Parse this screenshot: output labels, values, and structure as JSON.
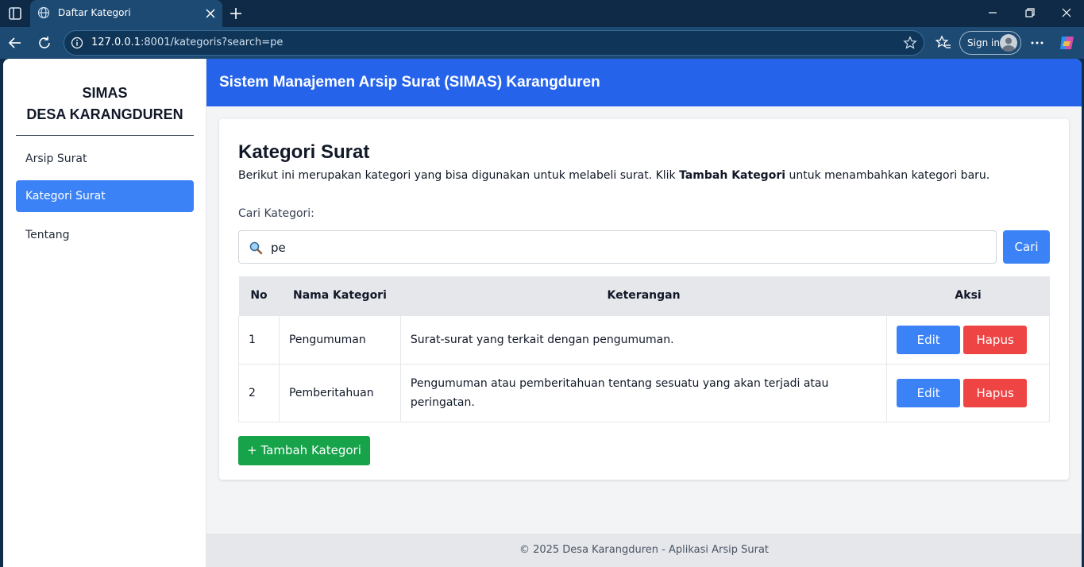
{
  "browser": {
    "tab_title": "Daftar Kategori",
    "url_host": "127.0.0.1",
    "url_rest": ":8001/kategoris?search=pe",
    "signin_label": "Sign in"
  },
  "sidebar": {
    "brand_line1": "SIMAS",
    "brand_line2": "DESA KARANGDUREN",
    "items": [
      {
        "label": "Arsip Surat",
        "active": false
      },
      {
        "label": "Kategori Surat",
        "active": true
      },
      {
        "label": "Tentang",
        "active": false
      }
    ]
  },
  "header": {
    "title": "Sistem Manajemen Arsip Surat (SIMAS) Karangduren"
  },
  "main": {
    "title": "Kategori Surat",
    "desc_before": "Berikut ini merupakan kategori yang bisa digunakan untuk melabeli surat. Klik ",
    "desc_bold": "Tambah Kategori",
    "desc_after": " untuk menambahkan kategori baru.",
    "search_label": "Cari Kategori:",
    "search_value": "pe",
    "search_button": "Cari",
    "columns": [
      "No",
      "Nama Kategori",
      "Keterangan",
      "Aksi"
    ],
    "rows": [
      {
        "no": "1",
        "nama": "Pengumuman",
        "keterangan": "Surat-surat yang terkait dengan pengumuman."
      },
      {
        "no": "2",
        "nama": "Pemberitahuan",
        "keterangan": "Pengumuman atau pemberitahuan tentang sesuatu yang akan terjadi atau peringatan."
      }
    ],
    "edit_label": "Edit",
    "delete_label": "Hapus",
    "add_button": "+ Tambah Kategori"
  },
  "footer": {
    "text": "© 2025 Desa Karangduren - Aplikasi Arsip Surat"
  },
  "colors": {
    "header": "#2563eb",
    "primary_button": "#3b82f6",
    "danger_button": "#ef4444",
    "success_button": "#16a34a"
  }
}
